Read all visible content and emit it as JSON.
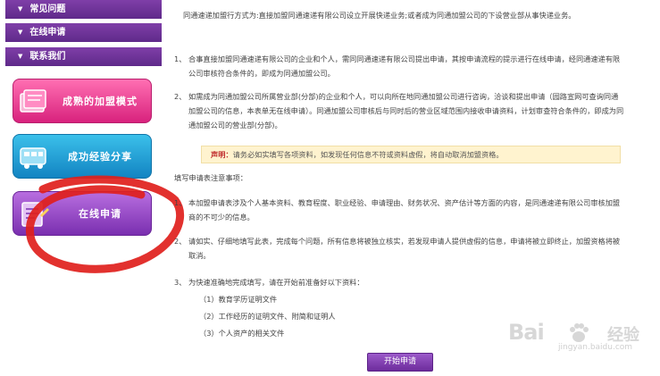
{
  "sidebar": {
    "nav": [
      {
        "label": "常见问题"
      },
      {
        "label": "在线申请"
      },
      {
        "label": "联系我们"
      }
    ],
    "banners": [
      {
        "label": "成熟的加盟模式",
        "icon": "book-icon",
        "color": "#d8227d"
      },
      {
        "label": "成功经验分享",
        "icon": "bus-icon",
        "color": "#1284c2"
      },
      {
        "label": "在线申请",
        "icon": "form-icon",
        "color": "#7a2fb0"
      }
    ]
  },
  "content": {
    "intro": "同通速递加盟行方式为:直接加盟同通速递有限公司设立开展快递业务;或者成为同通加盟公司的下设营业部从事快递业务。",
    "items": [
      {
        "num": "1、",
        "text": "合事直接加盟同通速递有限公司的企业和个人，需同同通速递有限公司提出申请，其按申请流程的提示进行在线申请，经同通速递有限公司审核符合条件的，即成为同通加盟公司。"
      },
      {
        "num": "2、",
        "text": "如需成为同通加盟公司所属营业部(分部)的企业和个人，可以向所在地同通加盟公司进行咨询，洽谈和提出申请（园路宣网可查询同通加盟公司的信息，本表单无在线申请）。同通加盟公司审核后与同时后的营业区域范围内接收申请资料，计划审查符合条件的，即成为同通加盟公司的营业部(分部)。"
      }
    ],
    "notice": {
      "prefix": "声明：",
      "text": "请务必如实填写各项资料，如发现任何信息不符或资料虚假，将自动取消加盟资格。"
    },
    "section_title": "填写申请表注意事项：",
    "rules": [
      {
        "num": "1、",
        "text": "本加盟申请表涉及个人基本资料、教育程度、职业经验、申请理由、财务状况、资产估计等方面的内容，是同通速递有限公司审核加盟商的不可少的信息。"
      },
      {
        "num": "2、",
        "text": "请如实、仔细地填写此表，完成每个问题，所有信息将被独立核实，若发现申请人提供虚假的信息，申请将被立即终止，加盟资格将被取消。"
      },
      {
        "num": "3、",
        "text": "为快速准确地完成填写，请在开始前准备好以下资料："
      }
    ],
    "docs": [
      "（1）教育学历证明文件",
      "（2）工作经历的证明文件、附简和证明人",
      "（3）个人资产的相关文件"
    ],
    "apply_button": "开始申请"
  },
  "watermark": {
    "brand": "Bai",
    "suffix": "经验",
    "url": "jingyan.baidu.com"
  },
  "colors": {
    "purple": "#6d2c9c",
    "pink": "#d8227d",
    "blue": "#1284c2",
    "red_mark": "#e0201c"
  }
}
